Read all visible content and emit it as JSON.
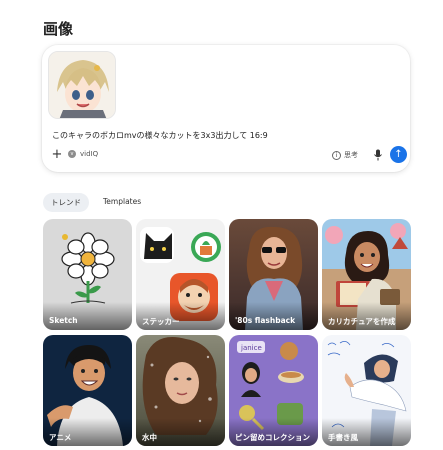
{
  "page": {
    "title": "画像"
  },
  "composer": {
    "prompt": "このキャラのボカロmvの様々なカットを3x3出力して 16:9",
    "plus_icon": "plus-icon",
    "tool_label": "vidIQ",
    "think_label": "思考",
    "mic_icon": "mic-icon",
    "send_icon": "arrow-up-icon",
    "accent": "#1a73e8"
  },
  "tabs": [
    {
      "label": "トレンド",
      "active": true
    },
    {
      "label": "Templates",
      "active": false
    }
  ],
  "cards": [
    {
      "label": "Sketch"
    },
    {
      "label": "ステッカー"
    },
    {
      "label": "'80s flashback"
    },
    {
      "label": "カリカチュアを作成"
    },
    {
      "label": "アニメ"
    },
    {
      "label": "水中"
    },
    {
      "label": "ピン留めコレクション"
    },
    {
      "label": "手書き風"
    }
  ]
}
